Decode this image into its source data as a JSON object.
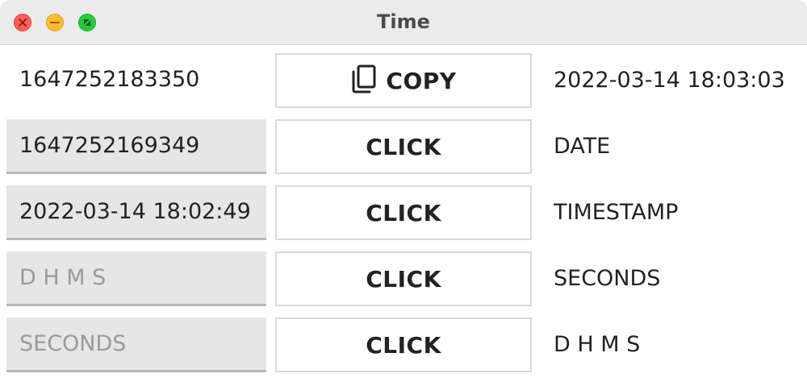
{
  "window": {
    "title": "Time"
  },
  "rows": [
    {
      "left_value": "1647252183350",
      "left_placeholder": "",
      "button_label": "COPY",
      "button_icon": "copy-icon",
      "right_text": "2022-03-14 18:03:03"
    },
    {
      "left_value": "1647252169349",
      "left_placeholder": "",
      "button_label": "CLICK",
      "right_text": "DATE"
    },
    {
      "left_value": "2022-03-14 18:02:49",
      "left_placeholder": "",
      "button_label": "CLICK",
      "right_text": "TIMESTAMP"
    },
    {
      "left_value": "",
      "left_placeholder": "D H M S",
      "button_label": "CLICK",
      "right_text": "SECONDS"
    },
    {
      "left_value": "",
      "left_placeholder": "SECONDS",
      "button_label": "CLICK",
      "right_text": "D H M S"
    }
  ],
  "colors": {
    "close": "#ff5f57",
    "minimize": "#febc2e",
    "zoom": "#28c840",
    "field_bg": "#e6e6e6",
    "placeholder": "#9a9a9a"
  }
}
